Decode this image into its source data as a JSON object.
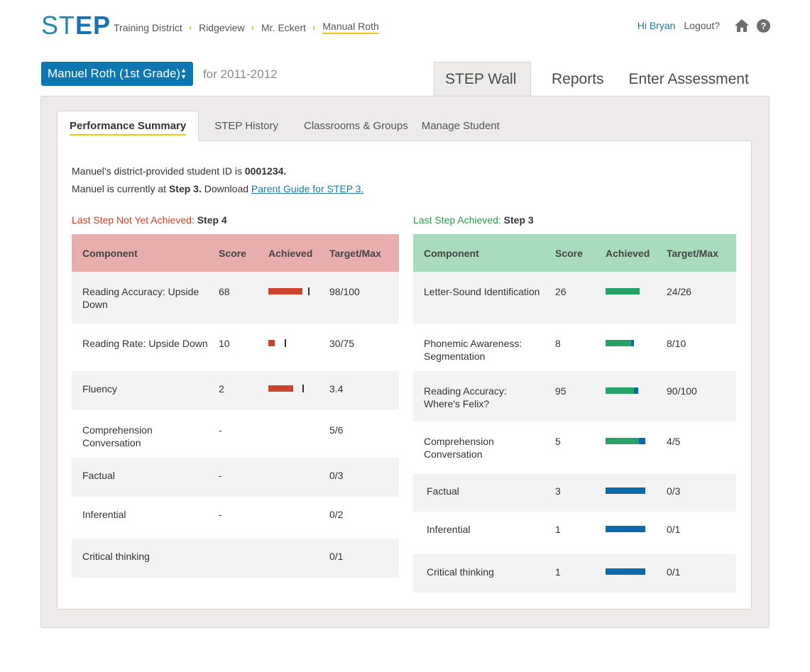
{
  "header": {
    "logo_st": "ST",
    "logo_ep": "EP",
    "breadcrumb": [
      "Training District",
      "Ridgeview",
      "Mr. Eckert",
      "Manual Roth"
    ],
    "greeting": "Hi Bryan",
    "logout": "Logout?",
    "help_symbol": "?",
    "icons": {
      "home": "home-icon",
      "help": "help-icon",
      "chevron": "chevron-right-icon"
    }
  },
  "student": {
    "selected": "Manuel Roth (1st Grade)",
    "year": "for 2011-2012"
  },
  "main_nav": [
    "STEP Wall",
    "Reports",
    "Enter Assessment"
  ],
  "sub_tabs": [
    "Performance Summary",
    "STEP History",
    "Classrooms & Groups",
    "Manage Student"
  ],
  "info": {
    "id_text": "Manuel's district-provided student ID is ",
    "id_value": "0001234.",
    "step_text_a": "Manuel is currently at ",
    "step_value": "Step 3.",
    "step_text_b": " Download ",
    "guide_link": "Parent Guide for STEP 3. "
  },
  "not_achieved": {
    "label": "Last Step Not Yet Achieved:",
    "step": "Step 4",
    "headers": [
      "Component",
      "Score",
      "Achieved",
      "Target/Max"
    ],
    "rows": [
      {
        "component": "Reading Accuracy: Upside Down",
        "score": "68",
        "target": "98/100",
        "bar_fill": 0.68,
        "bar_target": 0.98
      },
      {
        "component": "Reading Rate: Upside Down",
        "score": "10",
        "target": "30/75",
        "bar_fill": 0.13,
        "bar_target": 0.4
      },
      {
        "component": "Fluency",
        "score": "2",
        "target": "3.4",
        "bar_fill": 0.5,
        "bar_target": 0.85
      },
      {
        "component": "Comprehension Conversation",
        "score": "-",
        "target": "5/6"
      },
      {
        "component": "Factual",
        "score": "-",
        "target": "0/3"
      },
      {
        "component": "Inferential",
        "score": "-",
        "target": "0/2"
      },
      {
        "component": "Critical thinking",
        "score": "",
        "target": "0/1"
      }
    ],
    "bar_color": "#cc4430"
  },
  "achieved": {
    "label": "Last Step Achieved:",
    "step": "Step 3",
    "headers": [
      "Component",
      "Score",
      "Achieved",
      "Target/Max"
    ],
    "rows": [
      {
        "component": "Letter-Sound Identification",
        "score": "26",
        "target": "24/26",
        "green": 0.85,
        "blue": 0.0
      },
      {
        "component": "Phonemic Awareness: Segmentation",
        "score": "8",
        "target": "8/10",
        "green": 0.65,
        "blue": 0.08
      },
      {
        "component": "Reading Accuracy: Where's Felix?",
        "score": "95",
        "target": "90/100",
        "green": 0.72,
        "blue": 0.1
      },
      {
        "component": "Comprehension Conversation",
        "score": "5",
        "target": "4/5",
        "green": 0.84,
        "blue": 0.16
      },
      {
        "component": "Factual",
        "score": "3",
        "target": "0/3",
        "green": 0.0,
        "blue": 1.0
      },
      {
        "component": "Inferential",
        "score": "1",
        "target": "0/1",
        "green": 0.0,
        "blue": 1.0
      },
      {
        "component": "Critical thinking",
        "score": "1",
        "target": "0/1",
        "green": 0.0,
        "blue": 1.0
      }
    ],
    "green_color": "#27a36a",
    "blue_color": "#0a6aaa"
  }
}
